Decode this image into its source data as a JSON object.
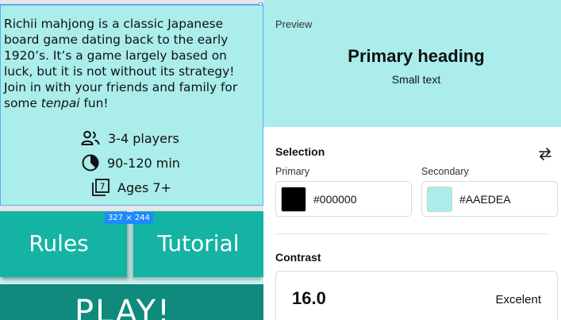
{
  "card": {
    "description_parts": [
      "Richii mahjong is a classic Japanese board game dating back to the early 1920’s. It’s a game largely based on luck, but it is not without its strategy! Join in with your friends and family for some ",
      "tenpai",
      " fun!"
    ],
    "stats": {
      "players": "3-4 players",
      "time": "90-120 min",
      "ages": "Ages 7+"
    },
    "age_icon_number": "7"
  },
  "selection_badge": "327 × 244",
  "buttons": {
    "rules": "Rules",
    "tutorial": "Tutorial",
    "play": "PLAY!"
  },
  "panel": {
    "preview": {
      "label": "Preview",
      "heading": "Primary heading",
      "small_text": "Small text"
    },
    "selection": {
      "title": "Selection",
      "swap_icon": "swap-arrows-icon",
      "primary_label": "Primary",
      "primary_hex": "#000000",
      "secondary_label": "Secondary",
      "secondary_hex": "#AAEDEA"
    },
    "contrast": {
      "title": "Contrast",
      "ratio": "16.0",
      "rating": "Excelent"
    }
  },
  "colors": {
    "card_bg": "#AAEDEA",
    "button_teal": "#14B3A3",
    "play_teal": "#0F8A7C",
    "selection_blue": "#1E88FF"
  }
}
